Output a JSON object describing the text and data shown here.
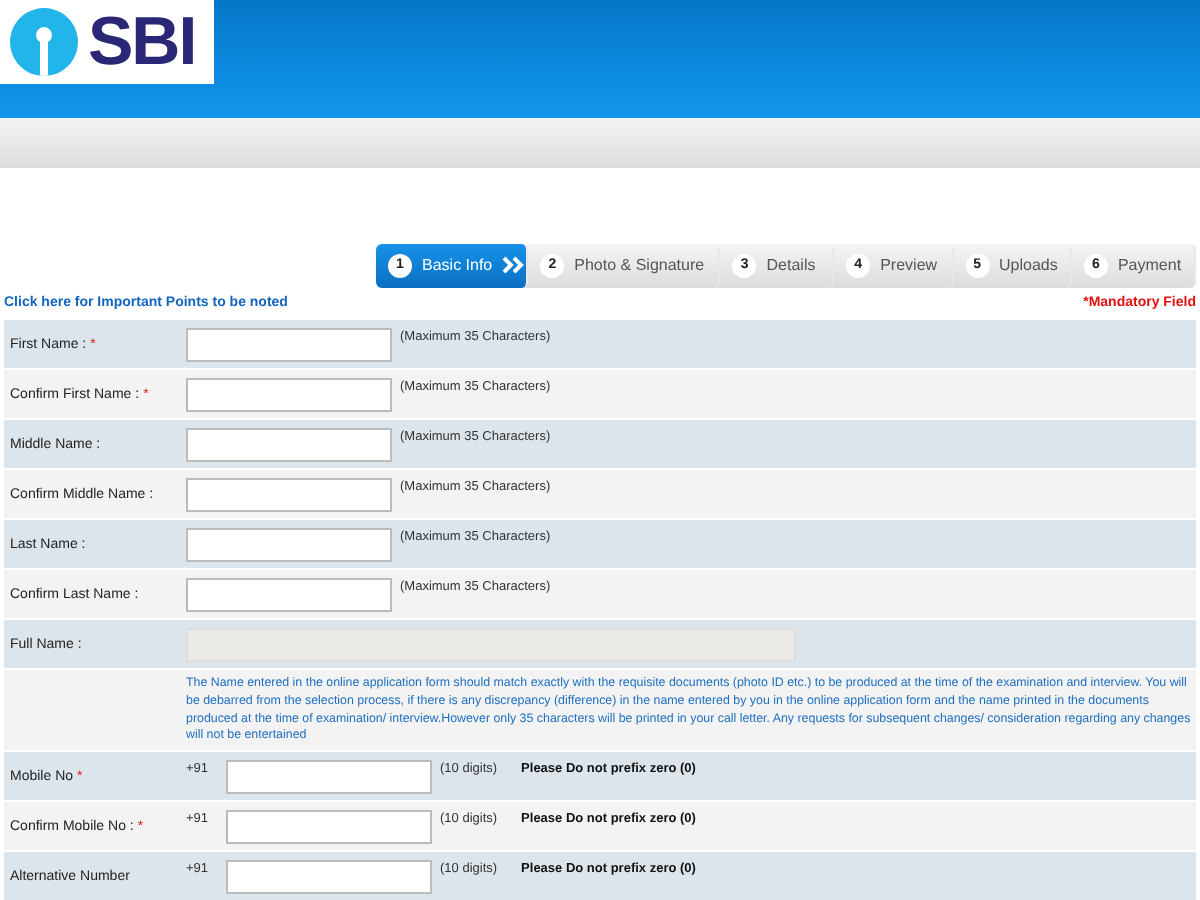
{
  "logo": {
    "text": "SBI"
  },
  "steps": [
    {
      "number": "1",
      "label": "Basic Info",
      "selected": true
    },
    {
      "number": "2",
      "label": "Photo & Signature",
      "selected": false
    },
    {
      "number": "3",
      "label": "Details",
      "selected": false
    },
    {
      "number": "4",
      "label": "Preview",
      "selected": false
    },
    {
      "number": "5",
      "label": "Uploads",
      "selected": false
    },
    {
      "number": "6",
      "label": "Payment",
      "selected": false
    }
  ],
  "notice_link": "Click here for Important Points to be noted",
  "mandatory_note": "*Mandatory Field",
  "form_rows": [
    {
      "kind": "text",
      "label": "First Name :",
      "mark": "*",
      "hint": "(Maximum 35 Characters)"
    },
    {
      "kind": "text",
      "label": "Confirm First Name :",
      "mark": "*",
      "hint": "(Maximum 35 Characters)"
    },
    {
      "kind": "text",
      "label": "Middle Name :",
      "hint": "(Maximum 35 Characters)"
    },
    {
      "kind": "text",
      "label": "Confirm Middle Name :",
      "hint": "(Maximum 35 Characters)"
    },
    {
      "kind": "text",
      "label": "Last Name :",
      "hint": "(Maximum 35 Characters)"
    },
    {
      "kind": "text",
      "label": "Confirm Last Name :",
      "hint": "(Maximum 35 Characters)"
    },
    {
      "kind": "readonly",
      "label": "Full Name :"
    },
    {
      "kind": "note",
      "text": "The Name entered in the online application form should match exactly with the requisite documents (photo ID etc.) to be produced at the time of the examination and interview. You will be debarred from the selection process, if there is any discrepancy (difference) in the name entered by you in the online application form and the name printed in the documents produced at the time of examination/ interview.However only 35 characters will be printed in your call letter. Any requests for subsequent changes/ consideration regarding any changes will not be entertained"
    },
    {
      "kind": "mobile",
      "label": "Mobile No",
      "mark": "*",
      "prefix": "+91",
      "hint": "(10 digits)",
      "warning": "Please Do not prefix zero (0)"
    },
    {
      "kind": "mobile",
      "label": "Confirm Mobile No :",
      "mark": "*",
      "prefix": "+91",
      "hint": "(10 digits)",
      "warning": "Please Do not prefix zero (0)"
    },
    {
      "kind": "mobile",
      "label": "Alternative Number",
      "prefix": "+91",
      "hint": "(10 digits)",
      "warning": "Please Do not prefix zero (0)"
    }
  ]
}
